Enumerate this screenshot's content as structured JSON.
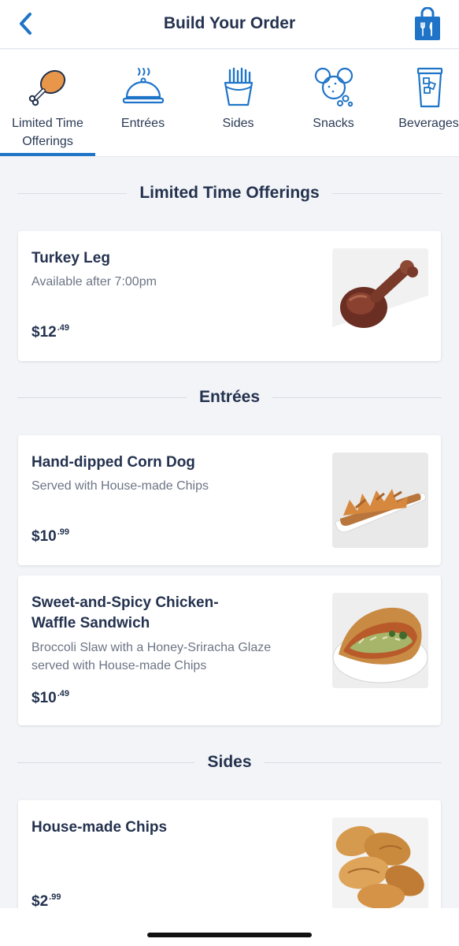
{
  "header": {
    "title": "Build Your Order",
    "back_icon": "chevron-left-icon",
    "bag_icon": "shopping-bag-icon"
  },
  "tabs": [
    {
      "label": "Limited Time Offerings",
      "icon": "turkey-leg-icon",
      "active": true
    },
    {
      "label": "Entrées",
      "icon": "cloche-icon",
      "active": false
    },
    {
      "label": "Sides",
      "icon": "fries-icon",
      "active": false
    },
    {
      "label": "Snacks",
      "icon": "mickey-snack-icon",
      "active": false
    },
    {
      "label": "Beverages",
      "icon": "drink-cup-icon",
      "active": false
    }
  ],
  "sections": {
    "limited": "Limited Time Offerings",
    "entrees": "Entrées",
    "sides": "Sides"
  },
  "items": [
    {
      "name": "Turkey Leg",
      "desc": "Available after 7:00pm",
      "price_main": "$12",
      "price_cents": ".49"
    },
    {
      "name": "Hand-dipped Corn Dog",
      "desc": "Served with House-made Chips",
      "price_main": "$10",
      "price_cents": ".99"
    },
    {
      "name": "Sweet-and-Spicy Chicken-Waffle Sandwich",
      "desc": "Broccoli Slaw with a Honey-Sriracha Glaze served with House-made Chips",
      "price_main": "$10",
      "price_cents": ".49"
    },
    {
      "name": "House-made Chips",
      "desc": "",
      "price_main": "$2",
      "price_cents": ".99"
    }
  ],
  "colors": {
    "accent": "#1f74c8",
    "text": "#24324f",
    "muted": "#6c7585",
    "background": "#f2f4f7"
  }
}
